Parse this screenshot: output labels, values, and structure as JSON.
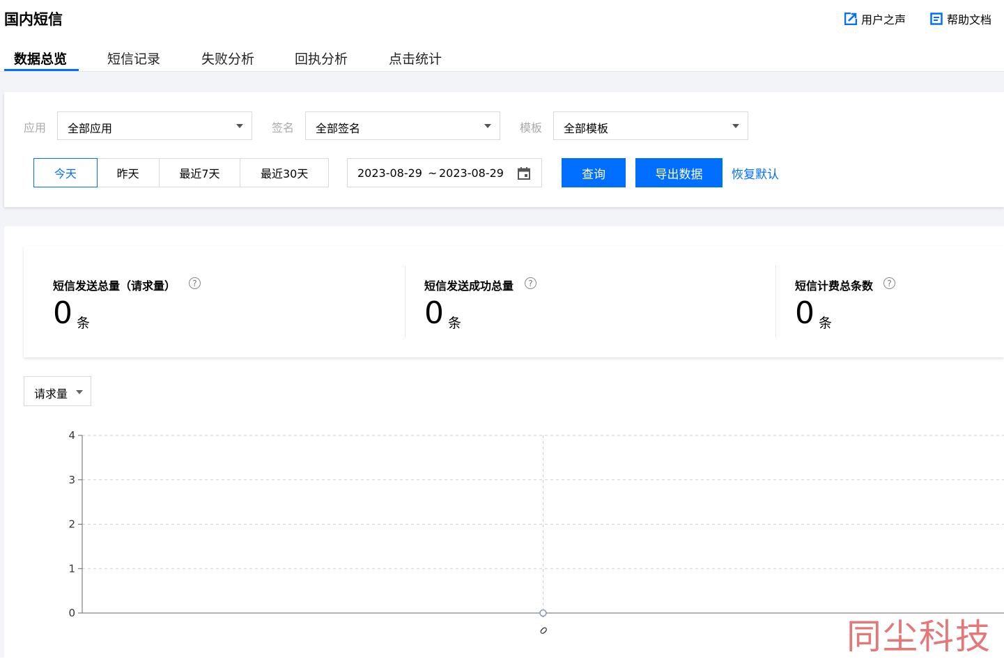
{
  "header": {
    "title": "国内短信",
    "links": [
      {
        "label": "用户之声",
        "icon": "external-link-icon"
      },
      {
        "label": "帮助文档",
        "icon": "document-icon"
      }
    ]
  },
  "tabs": [
    {
      "label": "数据总览",
      "active": true
    },
    {
      "label": "短信记录",
      "active": false
    },
    {
      "label": "失败分析",
      "active": false
    },
    {
      "label": "回执分析",
      "active": false
    },
    {
      "label": "点击统计",
      "active": false
    }
  ],
  "filters": {
    "app": {
      "label": "应用",
      "value": "全部应用"
    },
    "sign": {
      "label": "签名",
      "value": "全部签名"
    },
    "template": {
      "label": "模板",
      "value": "全部模板"
    },
    "ranges": [
      {
        "label": "今天",
        "active": true
      },
      {
        "label": "昨天",
        "active": false
      },
      {
        "label": "最近7天",
        "active": false
      },
      {
        "label": "最近30天",
        "active": false
      }
    ],
    "date_start": "2023-08-29",
    "date_sep": "~",
    "date_end": "2023-08-29",
    "query_label": "查询",
    "export_label": "导出数据",
    "reset_label": "恢复默认"
  },
  "stats": [
    {
      "label": "短信发送总量（请求量）",
      "value": "0",
      "unit": "条"
    },
    {
      "label": "短信发送成功总量",
      "value": "0",
      "unit": "条"
    },
    {
      "label": "短信计费总条数",
      "value": "0",
      "unit": "条"
    }
  ],
  "help_glyph": "?",
  "metric_select": {
    "value": "请求量"
  },
  "chart_data": {
    "type": "line",
    "x": [
      "0"
    ],
    "series": [
      {
        "values": [
          0
        ]
      }
    ],
    "ylim": [
      0,
      4
    ],
    "yticks": [
      "0",
      "1",
      "2",
      "3",
      "4"
    ],
    "grid": true,
    "accent_color": "#8a8fd6"
  },
  "watermark": "同尘科技",
  "colors": {
    "primary": "#006eff",
    "band": "#f3f4f7"
  }
}
